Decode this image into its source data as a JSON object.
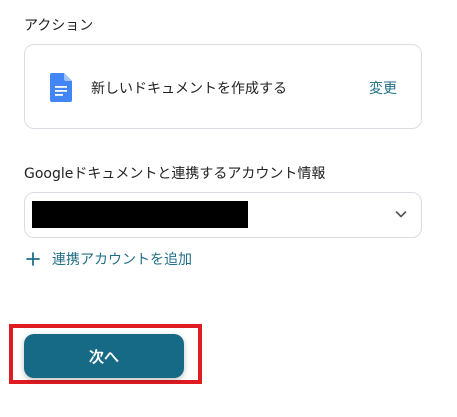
{
  "action": {
    "label": "アクション",
    "icon": "google-docs-icon",
    "title": "新しいドキュメントを作成する",
    "change_label": "変更"
  },
  "account": {
    "label": "Googleドキュメントと連携するアカウント情報",
    "selected_value_redacted": true,
    "add_link_label": "連携アカウントを追加"
  },
  "next_button": {
    "label": "次へ"
  },
  "colors": {
    "accent": "#166a85",
    "link": "#1f6e86",
    "highlight": "#e11b22",
    "docs_blue": "#4285f4"
  }
}
